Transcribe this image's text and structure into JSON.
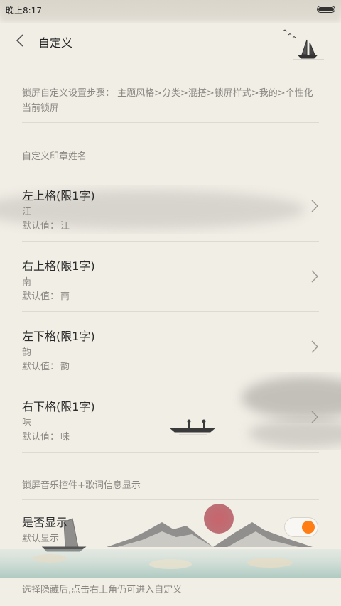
{
  "status_bar": {
    "time": "晚上8:17"
  },
  "header": {
    "title": "自定义"
  },
  "description": "锁屏自定义设置步骤： 主题风格>分类>混搭>锁屏样式>我的>个性化当前锁屏",
  "seal_section": {
    "title": "自定义印章姓名",
    "items": [
      {
        "title": "左上格(限1字)",
        "value": "江",
        "default_label": "默认值：",
        "default_value": "江"
      },
      {
        "title": "右上格(限1字)",
        "value": "南",
        "default_label": "默认值：",
        "default_value": "南"
      },
      {
        "title": "左下格(限1字)",
        "value": "韵",
        "default_label": "默认值：",
        "default_value": "韵"
      },
      {
        "title": "右下格(限1字)",
        "value": "味",
        "default_label": "默认值：",
        "default_value": "味"
      }
    ]
  },
  "music_section": {
    "title": "锁屏音乐控件+歌词信息显示",
    "toggle": {
      "title": "是否显示",
      "subtitle": "默认显示",
      "on": true
    }
  },
  "footer_note": "选择隐藏后,点击右上角仍可进入自定义",
  "colors": {
    "accent": "#ff7d12",
    "background": "#f1eee6",
    "sun": "#b7424e"
  },
  "icons": {
    "back": "chevron-left-icon",
    "row": "chevron-right-icon",
    "battery": "battery-icon"
  }
}
